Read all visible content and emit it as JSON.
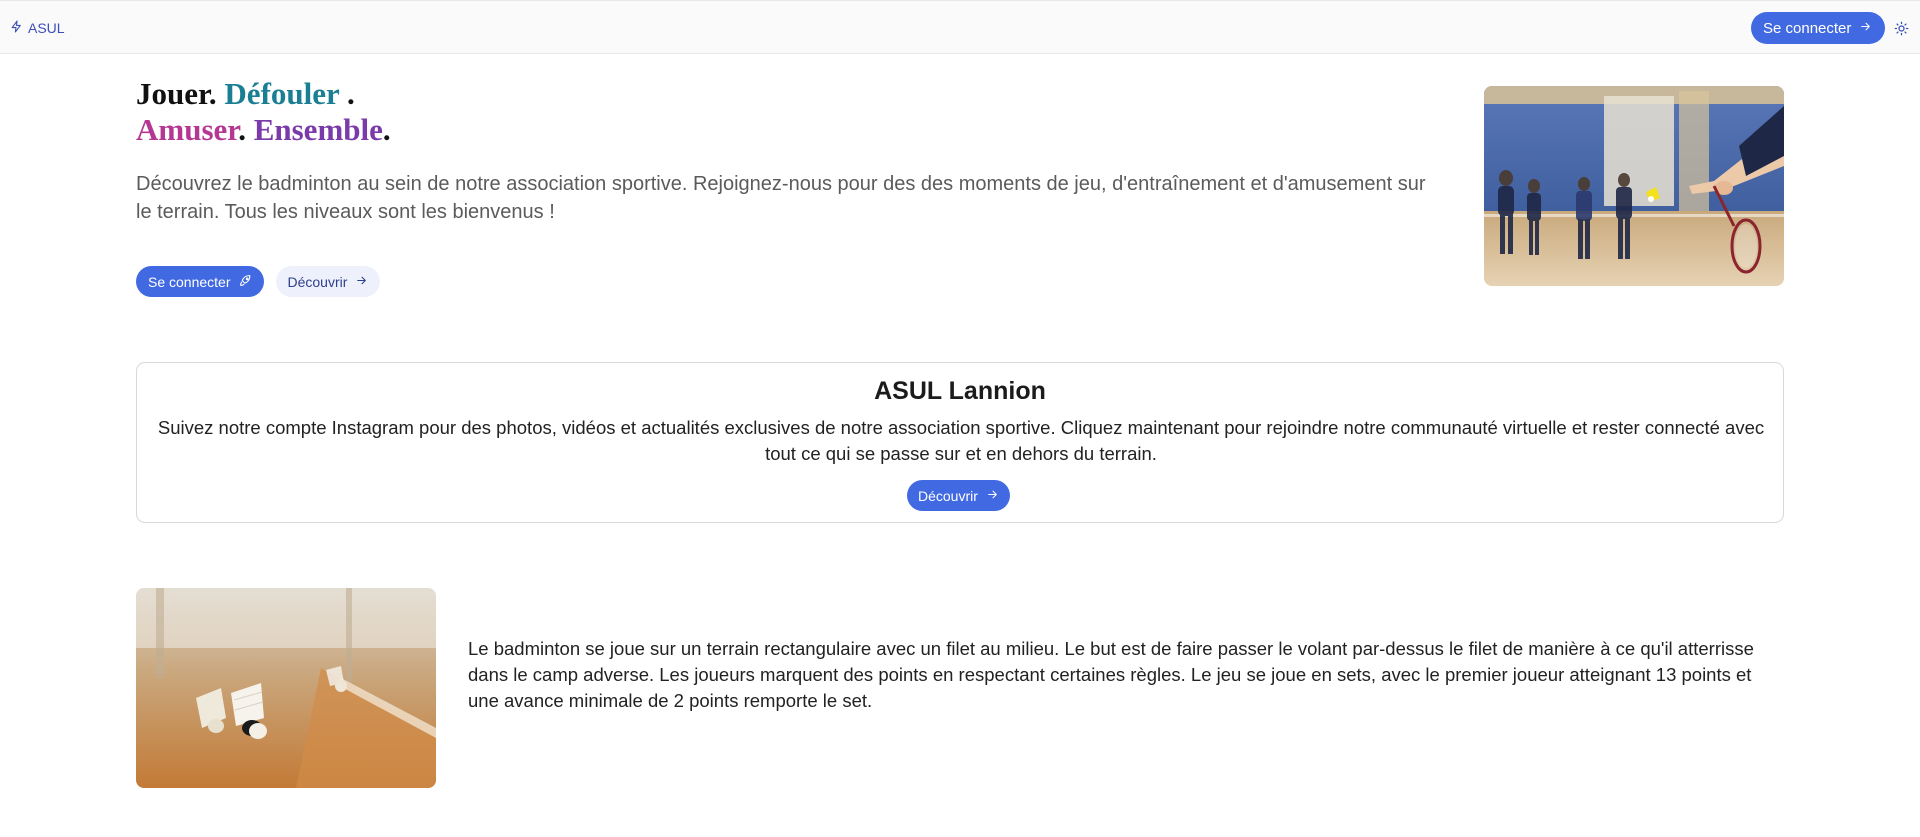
{
  "header": {
    "brand_label": "ASUL",
    "login_label": "Se connecter"
  },
  "hero": {
    "title_line1_a": "Jouer.",
    "title_line1_b": "Défouler",
    "title_line1_c": ".",
    "title_line2_a": "Amuser",
    "title_line2_dot1": ".",
    "title_line2_b": "Ensemble",
    "title_line2_dot2": ".",
    "description": "Découvrez le badminton au sein de notre association sportive. Rejoignez-nous pour des des moments de jeu, d'entraînement et d'amusement sur le terrain. Tous les niveaux sont les bienvenus !",
    "login_label": "Se connecter",
    "discover_label": "Découvrir"
  },
  "instagram_card": {
    "title": "ASUL Lannion",
    "text": "Suivez notre compte Instagram pour des photos, vidéos et actualités exclusives de notre association sportive. Cliquez maintenant pour rejoindre notre communauté virtuelle et rester connecté avec tout ce qui se passe sur et en dehors du terrain.",
    "discover_label": "Découvrir"
  },
  "info": {
    "text": "Le badminton se joue sur un terrain rectangulaire avec un filet au milieu. Le but est de faire passer le volant par-dessus le filet de manière à ce qu'il atterrisse dans le camp adverse. Les joueurs marquent des points en respectant certaines règles. Le jeu se joue en sets, avec le premier joueur atteignant 13 points et une avance minimale de 2 points remporte le set."
  },
  "colors": {
    "primary": "#4169e1",
    "soft_button": "#eef1fb",
    "teal": "#1b7f93",
    "magenta": "#b43793",
    "purple": "#7a3aa9"
  },
  "icons": [
    "bolt-icon",
    "arrow-right-icon",
    "sun-icon",
    "rocket-icon"
  ]
}
